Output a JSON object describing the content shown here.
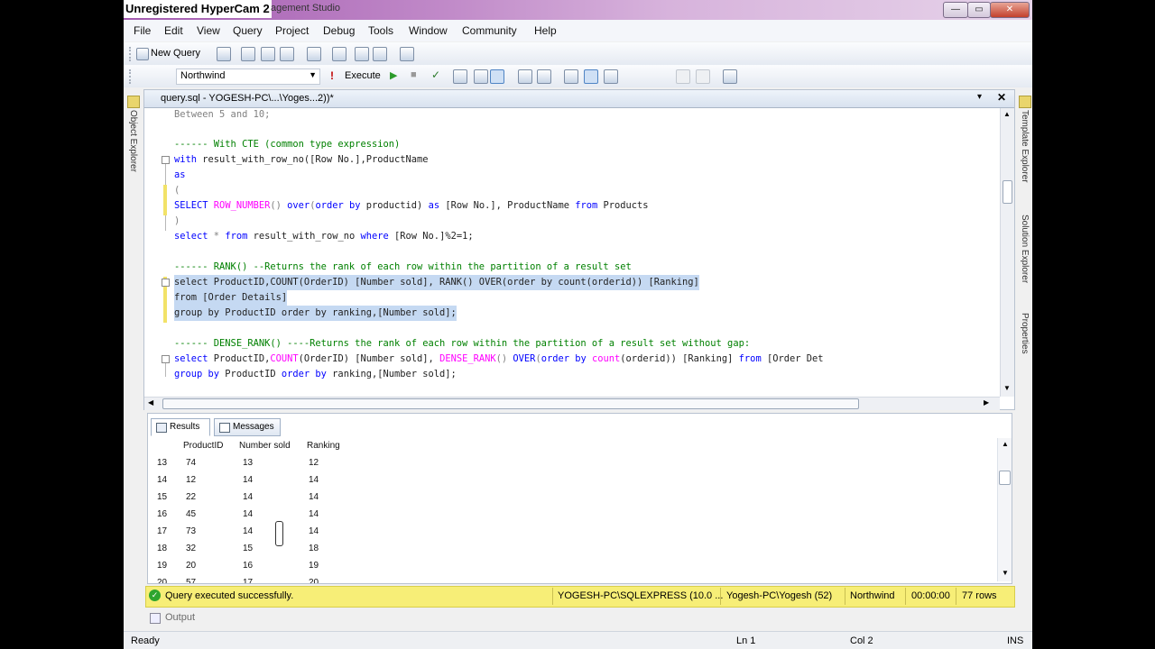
{
  "window": {
    "title": "Unregistered HyperCam 2",
    "title_suffix": "agement Studio",
    "btn_min": "—",
    "btn_max": "▭",
    "btn_close": "✕"
  },
  "menu": [
    "File",
    "Edit",
    "View",
    "Query",
    "Project",
    "Debug",
    "Tools",
    "Window",
    "Community",
    "Help"
  ],
  "toolbar1": {
    "new_query": "New Query"
  },
  "toolbar2": {
    "database": "Northwind",
    "execute": "Execute"
  },
  "left_sidebar": {
    "object_explorer": "Object Explorer"
  },
  "right_sidebar": {
    "template_explorer": "Template Explorer",
    "solution_explorer": "Solution Explorer",
    "properties": "Properties"
  },
  "document_tab": {
    "title": "query.sql - YOGESH-PC\\...\\Yoges...2))*",
    "close": "✕"
  },
  "editor": {
    "l1": "Between 5 and 10;",
    "l2": "------ With CTE (common type expression)",
    "l3a": "with",
    "l3b": " result_with_row_no([Row No.],ProductName",
    "l4": "as",
    "l5": "(",
    "l6a": "SELECT",
    "l6b": " ROW_NUMBER",
    "l6c": "() ",
    "l6d": "over",
    "l6e": "(",
    "l6f": "order by",
    "l6g": " productid) ",
    "l6h": "as",
    "l6i": " [Row No.], ProductName ",
    "l6j": "from",
    "l6k": " Products",
    "l7": ")",
    "l8a": "select",
    "l8b": " * ",
    "l8c": "from",
    "l8d": " result_with_row_no ",
    "l8e": "where",
    "l8f": " [Row No.]%2=1;",
    "l9": "------ RANK() --Returns the rank of each row within the partition of a result set",
    "l10": "select ProductID,COUNT(OrderID) [Number sold], RANK() OVER(order by count(orderid)) [Ranking]",
    "l11": "from [Order Details]",
    "l12": "group by ProductID order by ranking,[Number sold];",
    "l13": "------ DENSE_RANK() ----Returns the rank of each row within the partition of a result set without gap:",
    "l14a": "select",
    "l14b": " ProductID,",
    "l14c": "COUNT",
    "l14d": "(OrderID) [Number sold], ",
    "l14e": "DENSE_RANK",
    "l14f": "() ",
    "l14g": "OVER",
    "l14h": "(",
    "l14i": "order by",
    "l14j": " ",
    "l14k": "count",
    "l14l": "(orderid)) [Ranking] ",
    "l14m": "from",
    "l14n": " [Order Det",
    "l15a": "group by",
    "l15b": " ProductID ",
    "l15c": "order by",
    "l15d": " ranking,[Number sold];"
  },
  "results_tabs": {
    "results": "Results",
    "messages": "Messages"
  },
  "results": {
    "columns": [
      "ProductID",
      "Number sold",
      "Ranking"
    ],
    "rows": [
      [
        "13",
        "74",
        "13",
        "12"
      ],
      [
        "14",
        "12",
        "14",
        "14"
      ],
      [
        "15",
        "22",
        "14",
        "14"
      ],
      [
        "16",
        "45",
        "14",
        "14"
      ],
      [
        "17",
        "73",
        "14",
        "14"
      ],
      [
        "18",
        "32",
        "15",
        "18"
      ],
      [
        "19",
        "20",
        "16",
        "19"
      ],
      [
        "20",
        "57",
        "17",
        "20"
      ]
    ]
  },
  "status": {
    "message": "Query executed successfully.",
    "server": "YOGESH-PC\\SQLEXPRESS (10.0 ...",
    "user": "Yogesh-PC\\Yogesh (52)",
    "database": "Northwind",
    "time": "00:00:00",
    "rows": "77 rows"
  },
  "output_tab": "Output",
  "bottom": {
    "ready": "Ready",
    "ln": "Ln 1",
    "col": "Col 2",
    "ins": "INS"
  },
  "colors": {
    "status_yellow": "#f7ee77",
    "title_purple": "#a35ab0",
    "keyword": "#0000ff",
    "function": "#ff00ff",
    "comment": "#008000"
  }
}
